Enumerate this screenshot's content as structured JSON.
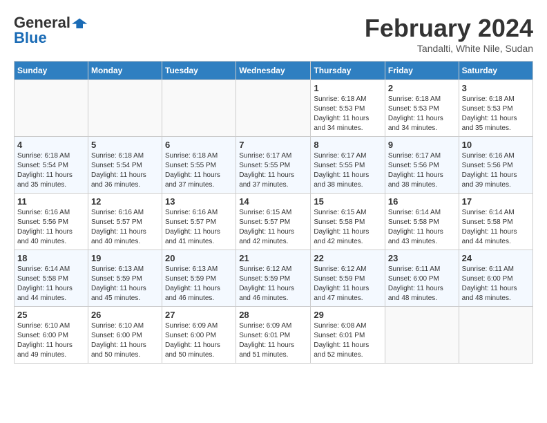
{
  "header": {
    "logo_general": "General",
    "logo_blue": "Blue",
    "month_year": "February 2024",
    "location": "Tandalti, White Nile, Sudan"
  },
  "weekdays": [
    "Sunday",
    "Monday",
    "Tuesday",
    "Wednesday",
    "Thursday",
    "Friday",
    "Saturday"
  ],
  "weeks": [
    [
      {
        "day": "",
        "empty": true
      },
      {
        "day": "",
        "empty": true
      },
      {
        "day": "",
        "empty": true
      },
      {
        "day": "",
        "empty": true
      },
      {
        "day": "1",
        "sunrise": "6:18 AM",
        "sunset": "5:53 PM",
        "daylight": "11 hours and 34 minutes."
      },
      {
        "day": "2",
        "sunrise": "6:18 AM",
        "sunset": "5:53 PM",
        "daylight": "11 hours and 34 minutes."
      },
      {
        "day": "3",
        "sunrise": "6:18 AM",
        "sunset": "5:53 PM",
        "daylight": "11 hours and 35 minutes."
      }
    ],
    [
      {
        "day": "4",
        "sunrise": "6:18 AM",
        "sunset": "5:54 PM",
        "daylight": "11 hours and 35 minutes."
      },
      {
        "day": "5",
        "sunrise": "6:18 AM",
        "sunset": "5:54 PM",
        "daylight": "11 hours and 36 minutes."
      },
      {
        "day": "6",
        "sunrise": "6:18 AM",
        "sunset": "5:55 PM",
        "daylight": "11 hours and 37 minutes."
      },
      {
        "day": "7",
        "sunrise": "6:17 AM",
        "sunset": "5:55 PM",
        "daylight": "11 hours and 37 minutes."
      },
      {
        "day": "8",
        "sunrise": "6:17 AM",
        "sunset": "5:55 PM",
        "daylight": "11 hours and 38 minutes."
      },
      {
        "day": "9",
        "sunrise": "6:17 AM",
        "sunset": "5:56 PM",
        "daylight": "11 hours and 38 minutes."
      },
      {
        "day": "10",
        "sunrise": "6:16 AM",
        "sunset": "5:56 PM",
        "daylight": "11 hours and 39 minutes."
      }
    ],
    [
      {
        "day": "11",
        "sunrise": "6:16 AM",
        "sunset": "5:56 PM",
        "daylight": "11 hours and 40 minutes."
      },
      {
        "day": "12",
        "sunrise": "6:16 AM",
        "sunset": "5:57 PM",
        "daylight": "11 hours and 40 minutes."
      },
      {
        "day": "13",
        "sunrise": "6:16 AM",
        "sunset": "5:57 PM",
        "daylight": "11 hours and 41 minutes."
      },
      {
        "day": "14",
        "sunrise": "6:15 AM",
        "sunset": "5:57 PM",
        "daylight": "11 hours and 42 minutes."
      },
      {
        "day": "15",
        "sunrise": "6:15 AM",
        "sunset": "5:58 PM",
        "daylight": "11 hours and 42 minutes."
      },
      {
        "day": "16",
        "sunrise": "6:14 AM",
        "sunset": "5:58 PM",
        "daylight": "11 hours and 43 minutes."
      },
      {
        "day": "17",
        "sunrise": "6:14 AM",
        "sunset": "5:58 PM",
        "daylight": "11 hours and 44 minutes."
      }
    ],
    [
      {
        "day": "18",
        "sunrise": "6:14 AM",
        "sunset": "5:58 PM",
        "daylight": "11 hours and 44 minutes."
      },
      {
        "day": "19",
        "sunrise": "6:13 AM",
        "sunset": "5:59 PM",
        "daylight": "11 hours and 45 minutes."
      },
      {
        "day": "20",
        "sunrise": "6:13 AM",
        "sunset": "5:59 PM",
        "daylight": "11 hours and 46 minutes."
      },
      {
        "day": "21",
        "sunrise": "6:12 AM",
        "sunset": "5:59 PM",
        "daylight": "11 hours and 46 minutes."
      },
      {
        "day": "22",
        "sunrise": "6:12 AM",
        "sunset": "5:59 PM",
        "daylight": "11 hours and 47 minutes."
      },
      {
        "day": "23",
        "sunrise": "6:11 AM",
        "sunset": "6:00 PM",
        "daylight": "11 hours and 48 minutes."
      },
      {
        "day": "24",
        "sunrise": "6:11 AM",
        "sunset": "6:00 PM",
        "daylight": "11 hours and 48 minutes."
      }
    ],
    [
      {
        "day": "25",
        "sunrise": "6:10 AM",
        "sunset": "6:00 PM",
        "daylight": "11 hours and 49 minutes."
      },
      {
        "day": "26",
        "sunrise": "6:10 AM",
        "sunset": "6:00 PM",
        "daylight": "11 hours and 50 minutes."
      },
      {
        "day": "27",
        "sunrise": "6:09 AM",
        "sunset": "6:00 PM",
        "daylight": "11 hours and 50 minutes."
      },
      {
        "day": "28",
        "sunrise": "6:09 AM",
        "sunset": "6:01 PM",
        "daylight": "11 hours and 51 minutes."
      },
      {
        "day": "29",
        "sunrise": "6:08 AM",
        "sunset": "6:01 PM",
        "daylight": "11 hours and 52 minutes."
      },
      {
        "day": "",
        "empty": true
      },
      {
        "day": "",
        "empty": true
      }
    ]
  ]
}
